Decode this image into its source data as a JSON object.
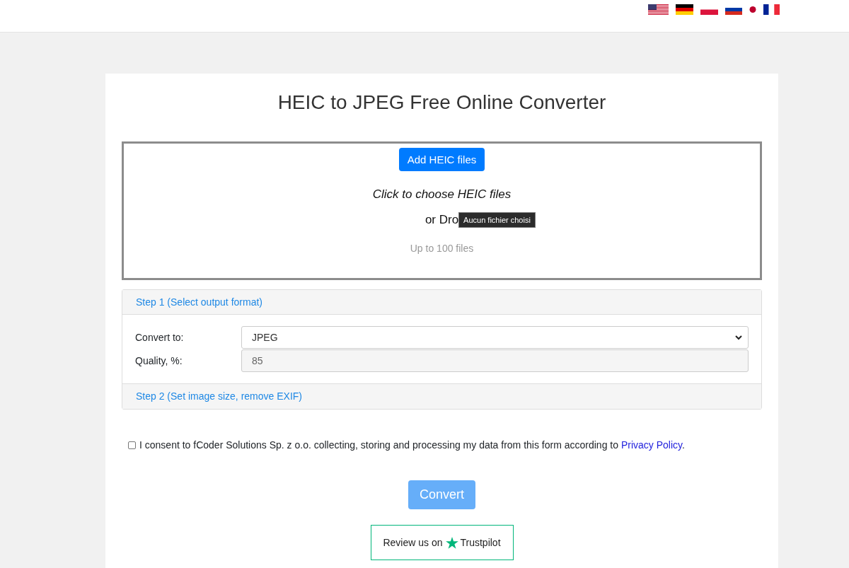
{
  "title": "HEIC to JPEG Free Online Converter",
  "dropzone": {
    "button": "Add HEIC files",
    "hint": "Click to choose HEIC files",
    "drop_text": "or Dro",
    "tooltip": "Aucun fichier choisi",
    "limit": "Up to 100 files"
  },
  "steps": [
    {
      "title": "Step 1 (Select output format)",
      "expanded": true
    },
    {
      "title": "Step 2 (Set image size, remove EXIF)",
      "expanded": false
    }
  ],
  "fields": [
    {
      "kind": "select",
      "label": "Convert to:",
      "value": "JPEG"
    },
    {
      "kind": "input",
      "label": "Quality, %:",
      "value": "85"
    }
  ],
  "consent": {
    "checked": false,
    "text": "I consent to fCoder Solutions Sp. z o.o. collecting, storing and processing my data from this form according to",
    "link": "Privacy Policy",
    "after": "."
  },
  "convert": {
    "label": "Convert",
    "disabled": true
  },
  "review": {
    "text": "Review us on",
    "brand": "Trustpilot"
  }
}
